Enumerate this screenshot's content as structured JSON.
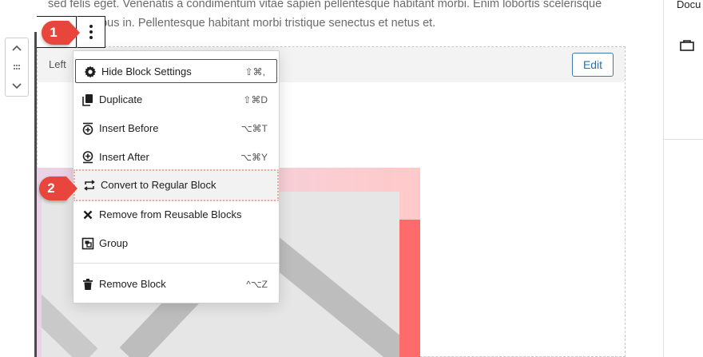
{
  "paragraph": {
    "line1": "sed felis eget. Venenatis a condimentum vitae sapien pellentesque habitant morbi. Enim lobortis scelerisque",
    "line2": "n dui faucibus in. Pellentesque habitant morbi tristique senectus et netus et."
  },
  "reusable_block": {
    "alignment_label": "Left",
    "edit_label": "Edit"
  },
  "sidebar": {
    "tab_label": "Docu"
  },
  "menu": {
    "items": [
      {
        "label": "Hide Block Settings",
        "shortcut": "⇧⌘,",
        "icon": "gear-icon"
      },
      {
        "label": "Duplicate",
        "shortcut": "⇧⌘D",
        "icon": "duplicate-icon"
      },
      {
        "label": "Insert Before",
        "shortcut": "⌥⌘T",
        "icon": "insert-before-icon"
      },
      {
        "label": "Insert After",
        "shortcut": "⌥⌘Y",
        "icon": "insert-after-icon"
      },
      {
        "label": "Convert to Regular Block",
        "shortcut": "",
        "icon": "convert-icon"
      },
      {
        "label": "Remove from Reusable Blocks",
        "shortcut": "",
        "icon": "close-icon"
      },
      {
        "label": "Group",
        "shortcut": "",
        "icon": "group-icon"
      },
      {
        "label": "Remove Block",
        "shortcut": "^⌥Z",
        "icon": "trash-icon"
      }
    ]
  },
  "callouts": {
    "step1": "1",
    "step2": "2"
  },
  "colors": {
    "callout": "#e8463c",
    "accent": "#2271b1",
    "highlight_border": "#f0a89a"
  }
}
